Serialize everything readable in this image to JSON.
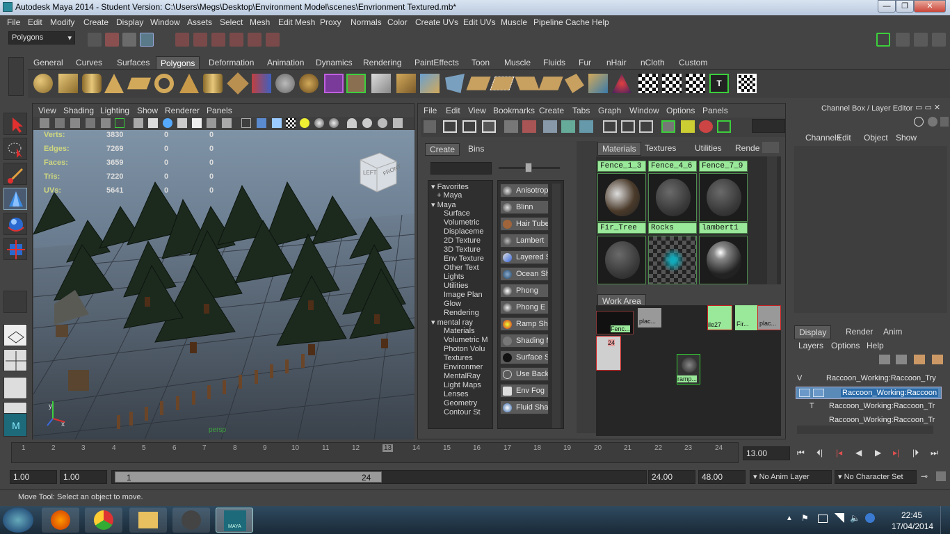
{
  "window": {
    "title": "Autodesk Maya 2014 - Student Version: C:\\Users\\Megs\\Desktop\\Environment Model\\scenes\\Envrionment Textured.mb*",
    "minimize": "—",
    "maximize": "❐",
    "close": "✕"
  },
  "menu": [
    "File",
    "Edit",
    "Modify",
    "Create",
    "Display",
    "Window",
    "Assets",
    "Select",
    "Mesh",
    "Edit Mesh",
    "Proxy",
    "Normals",
    "Color",
    "Create UVs",
    "Edit UVs",
    "Muscle",
    "Pipeline Cache",
    "Help"
  ],
  "status": {
    "mode": "Polygons"
  },
  "shelf_tabs": [
    "General",
    "Curves",
    "Surfaces",
    "Polygons",
    "Deformation",
    "Animation",
    "Dynamics",
    "Rendering",
    "PaintEffects",
    "Toon",
    "Muscle",
    "Fluids",
    "Fur",
    "nHair",
    "nCloth",
    "Custom"
  ],
  "shelf_active": "Polygons",
  "viewport": {
    "menu": [
      "View",
      "Shading",
      "Lighting",
      "Show",
      "Renderer",
      "Panels"
    ],
    "hud": [
      {
        "label": "Verts:",
        "v": "3830",
        "a": "0",
        "b": "0"
      },
      {
        "label": "Edges:",
        "v": "7269",
        "a": "0",
        "b": "0"
      },
      {
        "label": "Faces:",
        "v": "3659",
        "a": "0",
        "b": "0"
      },
      {
        "label": "Tris:",
        "v": "7220",
        "a": "0",
        "b": "0"
      },
      {
        "label": "UVs:",
        "v": "5641",
        "a": "0",
        "b": "0"
      }
    ],
    "cube_left": "LEFT",
    "cube_front": "FRONT",
    "camera": "persp",
    "axis_y": "y",
    "axis_x": "x"
  },
  "hypershade": {
    "menu": [
      "File",
      "Edit",
      "View",
      "Bookmarks",
      "Create",
      "Tabs",
      "Graph",
      "Window",
      "Options",
      "Panels"
    ],
    "create_tabs": [
      "Create",
      "Bins"
    ],
    "categories": [
      "Favorites",
      "+ Maya",
      "Maya",
      "Surface",
      "Volumetric",
      "Displaceme",
      "2D Texture",
      "3D Texture",
      "Env Texture",
      "Other Text",
      "Lights",
      "Utilities",
      "Image Plan",
      "Glow",
      "Rendering",
      "mental ray",
      "Materials",
      "Volumetric M",
      "Photon Volu",
      "Textures",
      "Environmer",
      "MentalRay",
      "Light Maps",
      "Lenses",
      "Geometry",
      "Contour St"
    ],
    "nodes": [
      "Anisotropic",
      "Blinn",
      "Hair Tube S",
      "Lambert",
      "Layered Sh",
      "Ocean Sha",
      "Phong",
      "Phong E",
      "Ramp Shad",
      "Shading Ma",
      "Surface Sh",
      "Use Backgr",
      "Env Fog",
      "Fluid Shape"
    ],
    "material_tabs": [
      "Materials",
      "Textures",
      "Utilities",
      "Rende"
    ],
    "swatch_top_labels": [
      "Fence_1_3",
      "Fence_4_6",
      "Fence_7_9"
    ],
    "swatch_labels": [
      "Fir_Tree",
      "Rocks",
      "lambert1"
    ],
    "work_area": "Work Area",
    "work_nodes": [
      "Fenc...",
      "plac...",
      "ile27",
      "Fir...",
      "plac...",
      "ramp...",
      "24"
    ]
  },
  "channel_box": {
    "title": "Channel Box / Layer Editor",
    "menu": [
      "Channels",
      "Edit",
      "Object",
      "Show"
    ],
    "layer_tabs": [
      "Display",
      "Render",
      "Anim"
    ],
    "layer_menu": [
      "Layers",
      "Options",
      "Help"
    ],
    "layers": [
      {
        "vis": "V",
        "type": "",
        "name": "Raccoon_Working:Raccoon_Try"
      },
      {
        "vis": "",
        "type": "",
        "name": "Raccoon_Working:Raccoon"
      },
      {
        "vis": "",
        "type": "T",
        "name": "Raccoon_Working:Raccoon_Tr"
      },
      {
        "vis": "",
        "type": "",
        "name": "Raccoon_Working:Raccoon_Tr"
      }
    ]
  },
  "timeline": {
    "ticks": [
      "1",
      "2",
      "3",
      "4",
      "5",
      "6",
      "7",
      "8",
      "9",
      "10",
      "11",
      "12",
      "13",
      "14",
      "15",
      "16",
      "17",
      "18",
      "19",
      "20",
      "21",
      "22",
      "23",
      "24"
    ],
    "current": "13.00"
  },
  "range": {
    "start": "1.00",
    "start2": "1.00",
    "slider_start": "1",
    "slider_end": "24",
    "end": "24.00",
    "end2": "48.00",
    "anim_layer": "No Anim Layer",
    "char_set": "No Character Set"
  },
  "help_line": "Move Tool: Select an object to move.",
  "taskbar": {
    "time": "22:45",
    "date": "17/04/2014",
    "maya_label": "MAYA"
  }
}
